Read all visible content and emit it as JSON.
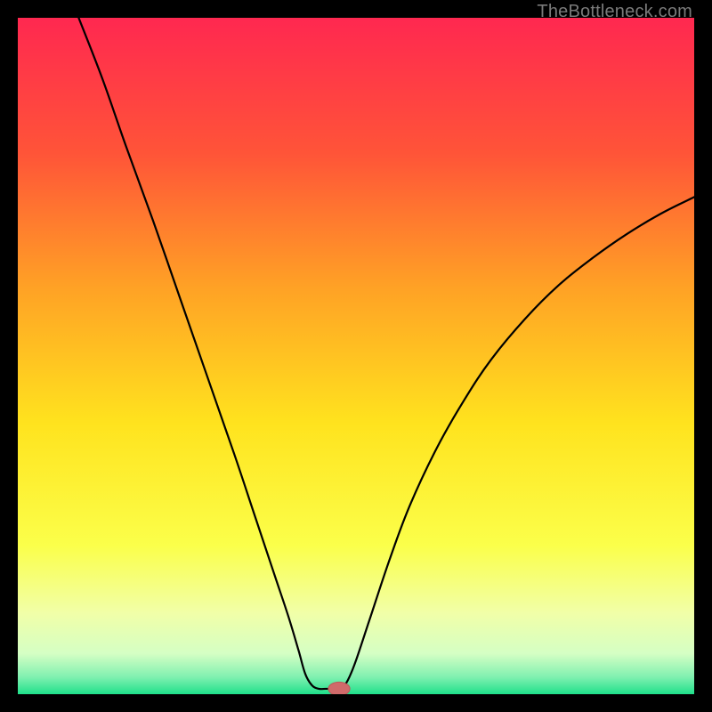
{
  "watermark": "TheBottleneck.com",
  "colors": {
    "frame": "#000000",
    "curve": "#000000",
    "marker_fill": "#d06a6a",
    "marker_stroke": "#bb5a5a"
  },
  "chart_data": {
    "type": "line",
    "title": "",
    "xlabel": "",
    "ylabel": "",
    "xlim": [
      0,
      100
    ],
    "ylim": [
      0,
      100
    ],
    "grid": false,
    "background": {
      "type": "vertical-gradient",
      "stops": [
        {
          "pos": 0.0,
          "color": "#ff2850"
        },
        {
          "pos": 0.2,
          "color": "#ff5438"
        },
        {
          "pos": 0.4,
          "color": "#ffa225"
        },
        {
          "pos": 0.6,
          "color": "#ffe31e"
        },
        {
          "pos": 0.78,
          "color": "#fbff4a"
        },
        {
          "pos": 0.88,
          "color": "#f1ffa8"
        },
        {
          "pos": 0.94,
          "color": "#d5ffc4"
        },
        {
          "pos": 0.975,
          "color": "#7ff0b0"
        },
        {
          "pos": 1.0,
          "color": "#1fe08a"
        }
      ]
    },
    "series": [
      {
        "name": "bottleneck-curve",
        "type": "line",
        "color": "#000000",
        "points": [
          {
            "x": 9.0,
            "y": 100.0
          },
          {
            "x": 12.5,
            "y": 91.0
          },
          {
            "x": 16.0,
            "y": 81.0
          },
          {
            "x": 20.0,
            "y": 70.0
          },
          {
            "x": 24.0,
            "y": 58.5
          },
          {
            "x": 28.0,
            "y": 47.0
          },
          {
            "x": 32.0,
            "y": 35.5
          },
          {
            "x": 35.0,
            "y": 26.5
          },
          {
            "x": 38.0,
            "y": 17.5
          },
          {
            "x": 40.0,
            "y": 11.5
          },
          {
            "x": 41.5,
            "y": 6.5
          },
          {
            "x": 42.5,
            "y": 3.0
          },
          {
            "x": 43.5,
            "y": 1.3
          },
          {
            "x": 44.5,
            "y": 0.8
          },
          {
            "x": 45.5,
            "y": 0.8
          },
          {
            "x": 46.5,
            "y": 0.8
          },
          {
            "x": 47.5,
            "y": 0.8
          },
          {
            "x": 48.3,
            "y": 1.3
          },
          {
            "x": 49.0,
            "y": 2.5
          },
          {
            "x": 50.0,
            "y": 5.0
          },
          {
            "x": 52.0,
            "y": 11.0
          },
          {
            "x": 55.0,
            "y": 20.0
          },
          {
            "x": 58.0,
            "y": 28.0
          },
          {
            "x": 62.0,
            "y": 36.5
          },
          {
            "x": 66.0,
            "y": 43.5
          },
          {
            "x": 70.0,
            "y": 49.5
          },
          {
            "x": 75.0,
            "y": 55.5
          },
          {
            "x": 80.0,
            "y": 60.5
          },
          {
            "x": 85.0,
            "y": 64.5
          },
          {
            "x": 90.0,
            "y": 68.0
          },
          {
            "x": 95.0,
            "y": 71.0
          },
          {
            "x": 100.0,
            "y": 73.5
          }
        ]
      }
    ],
    "marker": {
      "x": 47.5,
      "y": 0.8,
      "rx": 1.6,
      "ry": 1.0
    }
  }
}
